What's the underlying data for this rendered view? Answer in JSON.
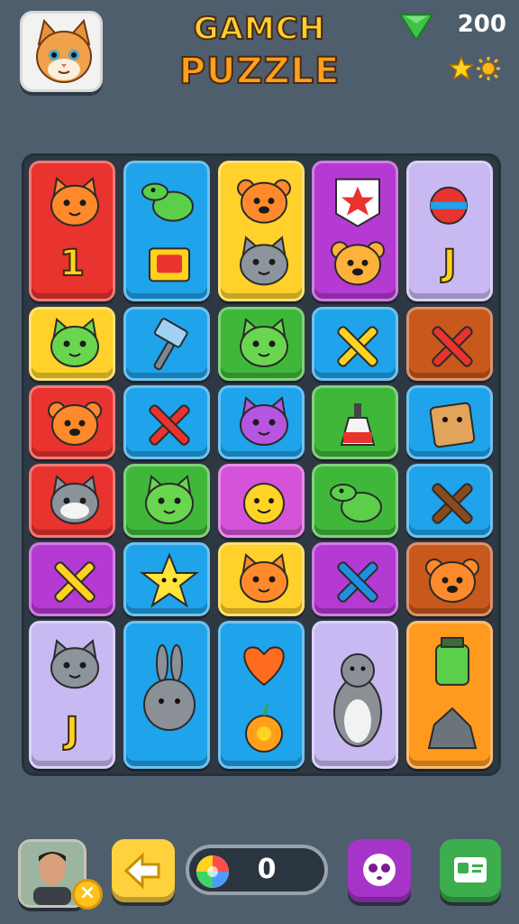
{
  "header": {
    "title_line1": "GAMCH",
    "title_line2": "PUZZLE",
    "gem_count": "200",
    "profile_icon": "cat-face-icon",
    "gem_icon": "green-gem-icon",
    "star_icon": "star-icon",
    "sun_icon": "sun-icon"
  },
  "board": {
    "rows": 6,
    "columns": 5,
    "tiles": [
      {
        "color": "red",
        "icons": [
          "orange-cat-icon"
        ],
        "label": "1"
      },
      {
        "color": "blue",
        "icons": [
          "green-dinosaur-icon",
          "red-box-icon"
        ],
        "label": ""
      },
      {
        "color": "yellow",
        "icons": [
          "orange-bear-icon",
          "gray-cat-icon"
        ],
        "label": ""
      },
      {
        "color": "purple",
        "icons": [
          "star-shield-icon",
          "orange-tiger-icon"
        ],
        "label": ""
      },
      {
        "color": "lavender",
        "icons": [
          "striped-ball-icon"
        ],
        "label": "J"
      },
      {
        "color": "yellow",
        "icons": [
          "green-cat-icon"
        ],
        "label": ""
      },
      {
        "color": "blue",
        "icons": [
          "hammer-icon"
        ],
        "label": ""
      },
      {
        "color": "green",
        "icons": [
          "green-cat-icon"
        ],
        "label": ""
      },
      {
        "color": "blue",
        "icons": [
          "yellow-x-icon"
        ],
        "label": ""
      },
      {
        "color": "brown",
        "icons": [
          "red-x-icon"
        ],
        "label": ""
      },
      {
        "color": "red",
        "icons": [
          "orange-bear-icon"
        ],
        "label": ""
      },
      {
        "color": "blue",
        "icons": [
          "red-x-icon"
        ],
        "label": ""
      },
      {
        "color": "blue",
        "icons": [
          "purple-cat-icon"
        ],
        "label": ""
      },
      {
        "color": "green",
        "icons": [
          "paint-bottle-icon"
        ],
        "label": ""
      },
      {
        "color": "blue",
        "icons": [
          "brown-block-icon"
        ],
        "label": ""
      },
      {
        "color": "red",
        "icons": [
          "raccoon-icon"
        ],
        "label": ""
      },
      {
        "color": "green",
        "icons": [
          "green-cat-icon"
        ],
        "label": ""
      },
      {
        "color": "magenta",
        "icons": [
          "yellow-cat-icon"
        ],
        "label": ""
      },
      {
        "color": "green",
        "icons": [
          "green-dinosaur-icon"
        ],
        "label": ""
      },
      {
        "color": "blue",
        "icons": [
          "brown-x-icon"
        ],
        "label": ""
      },
      {
        "color": "purple",
        "icons": [
          "yellow-x-icon"
        ],
        "label": ""
      },
      {
        "color": "blue",
        "icons": [
          "yellow-star-icon"
        ],
        "label": ""
      },
      {
        "color": "yellow",
        "icons": [
          "orange-cat-icon"
        ],
        "label": ""
      },
      {
        "color": "purple",
        "icons": [
          "blue-x-icon"
        ],
        "label": ""
      },
      {
        "color": "brown",
        "icons": [
          "orange-bear-icon"
        ],
        "label": ""
      },
      {
        "color": "lavender",
        "icons": [
          "gray-cat-icon"
        ],
        "label": "J"
      },
      {
        "color": "blue",
        "icons": [
          "gray-rabbit-icon"
        ],
        "label": ""
      },
      {
        "color": "blue",
        "icons": [
          "orange-heart-icon",
          "orange-flower-icon"
        ],
        "label": ""
      },
      {
        "color": "lavender",
        "icons": [
          "gray-bear-icon"
        ],
        "label": ""
      },
      {
        "color": "orange",
        "icons": [
          "green-jar-icon",
          "gray-rock-icon"
        ],
        "label": ""
      }
    ]
  },
  "bottom_bar": {
    "player_photo_icon": "player-photo-icon",
    "close_icon": "close-icon",
    "back_icon": "back-arrow-icon",
    "orb_icon": "rainbow-orb-icon",
    "counter_value": "0",
    "face_icon": "ghost-face-icon",
    "card_icon": "card-icon"
  },
  "colors": {
    "background": "#4f5e6d",
    "red": "#e8332f",
    "blue": "#1fa3ea",
    "yellow": "#ffd12a",
    "purple": "#b53ad3",
    "lavender": "#c8b9f2",
    "green": "#3fb83a",
    "brown": "#c9581d",
    "magenta": "#d553d9",
    "orange": "#ff9a1e"
  }
}
